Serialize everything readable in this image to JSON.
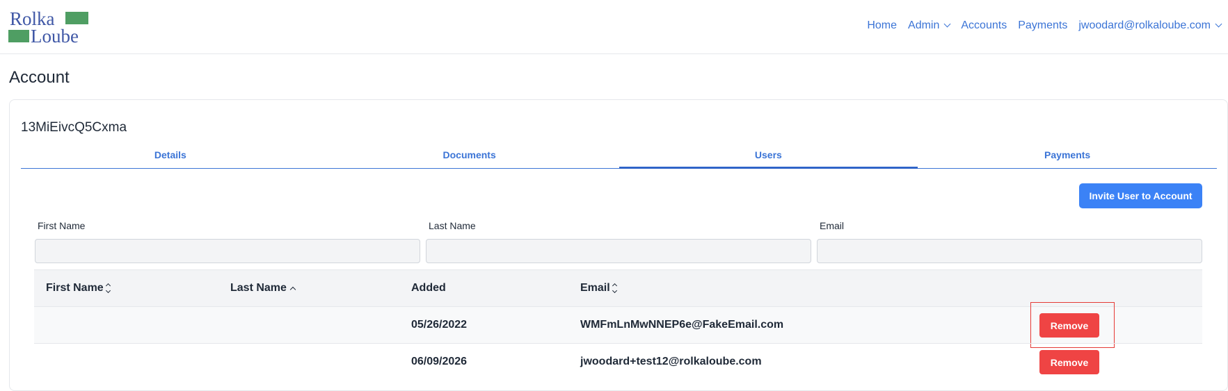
{
  "logo": {
    "line1": "Rolka",
    "line2": "Loube",
    "colors": {
      "text": "#3f57a6",
      "block": "#4f9e63"
    }
  },
  "nav": {
    "home": "Home",
    "admin": "Admin",
    "accounts": "Accounts",
    "payments": "Payments",
    "user": "jwoodard@rolkaloube.com"
  },
  "page": {
    "title": "Account"
  },
  "account": {
    "id": "13MiEivcQ5Cxma"
  },
  "tabs": [
    {
      "label": "Details",
      "active": false
    },
    {
      "label": "Documents",
      "active": false
    },
    {
      "label": "Users",
      "active": true
    },
    {
      "label": "Payments",
      "active": false
    }
  ],
  "actions": {
    "invite_label": "Invite User to Account"
  },
  "filters": {
    "first_name_label": "First Name",
    "last_name_label": "Last Name",
    "email_label": "Email",
    "first_name_value": "",
    "last_name_value": "",
    "email_value": ""
  },
  "table": {
    "columns": {
      "first_name": "First Name",
      "last_name": "Last Name",
      "added": "Added",
      "email": "Email"
    },
    "rows": [
      {
        "first_name": "",
        "last_name": "",
        "added": "05/26/2022",
        "email": "WMFmLnMwNNEP6e@FakeEmail.com",
        "action": "Remove"
      },
      {
        "first_name": "",
        "last_name": "",
        "added": "06/09/2026",
        "email": "jwoodard+test12@rolkaloube.com",
        "action": "Remove"
      }
    ]
  },
  "colors": {
    "primary": "#3b82f6",
    "link": "#3b74d6",
    "danger": "#ef4444",
    "highlight": "#e53935"
  }
}
